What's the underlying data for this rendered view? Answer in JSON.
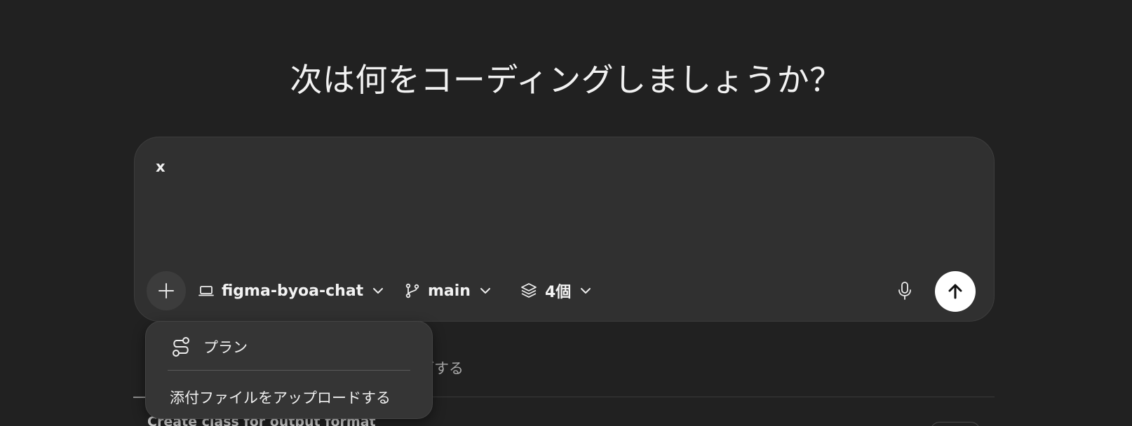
{
  "heading": "次は何をコーディングしましょうか？",
  "composer": {
    "input_value": "x",
    "repo": "figma-byoa-chat",
    "branch": "main",
    "count": "4個"
  },
  "background": {
    "tab_partial": "ブする",
    "task_title": "Create class for output format"
  },
  "menu": {
    "plan_label": "プラン",
    "upload_label": "添付ファイルをアップロードする"
  },
  "colors": {
    "background": "#212121",
    "composer": "#303030",
    "menu": "#353535",
    "send_button": "#ffffff"
  }
}
